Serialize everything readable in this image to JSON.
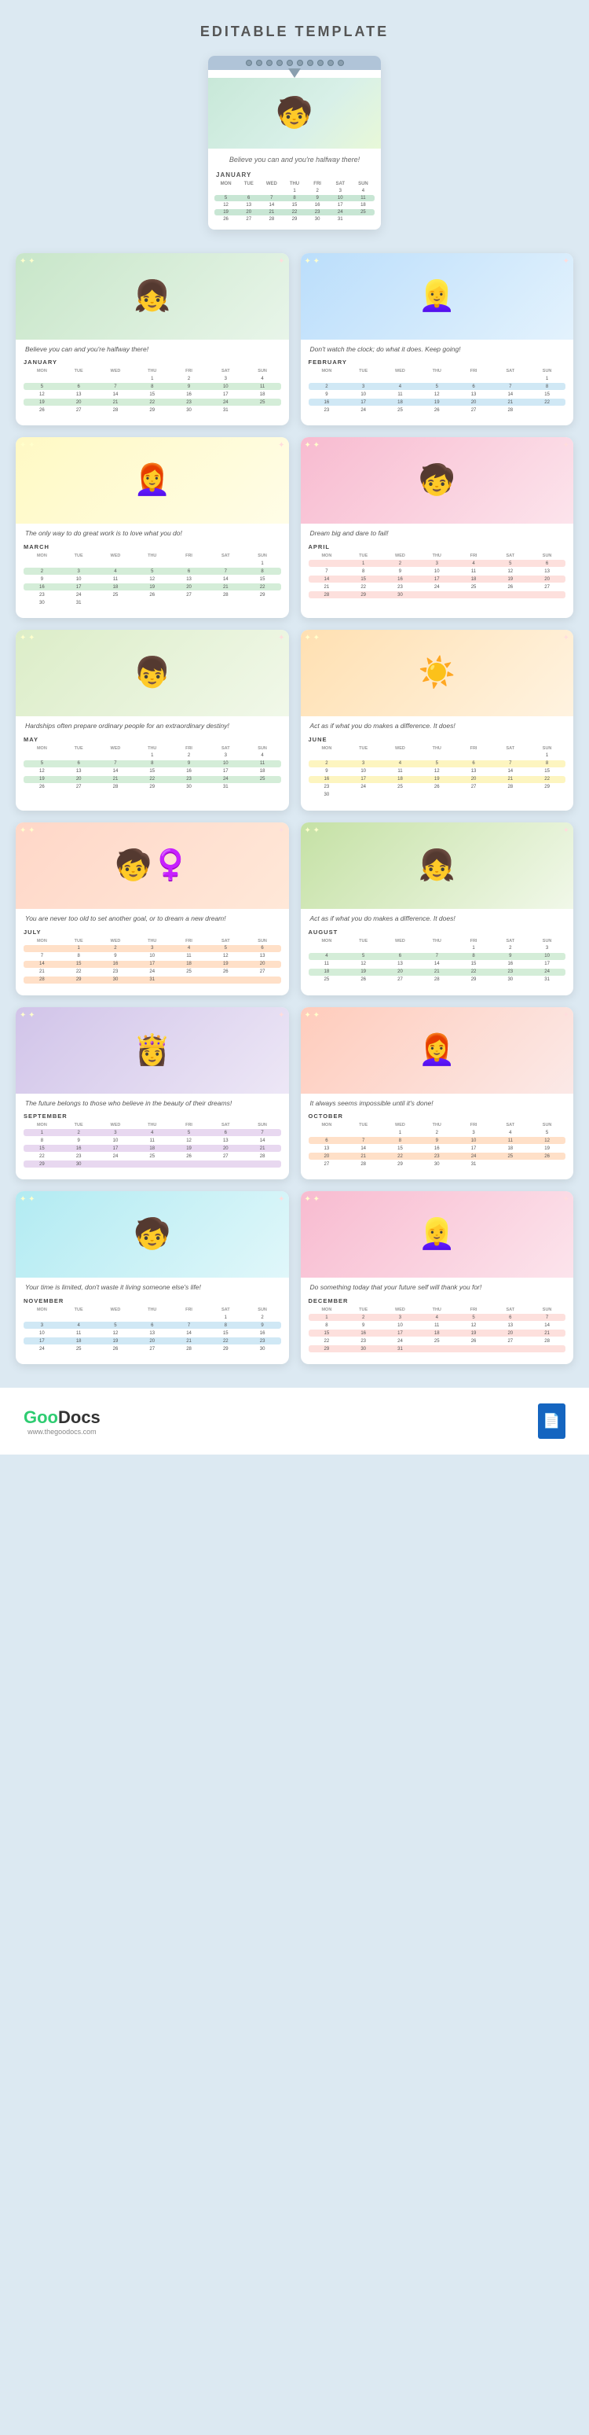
{
  "page": {
    "title": "EDITABLE TEMPLATE",
    "background_color": "#dce9f2"
  },
  "hero": {
    "quote": "Believe you can and you're halfway there!",
    "month": "JANUARY",
    "spiral_count": 12
  },
  "months": [
    {
      "id": "january",
      "label": "JANUARY",
      "quote": "Believe you can and you're halfway there!",
      "emoji": "👧",
      "illus_class": "illus-jan",
      "rows": [
        [
          "",
          "",
          "",
          "1",
          "2",
          "3",
          "4"
        ],
        [
          "5",
          "6",
          "7",
          "8",
          "9",
          "10",
          "11"
        ],
        [
          "12",
          "13",
          "14",
          "15",
          "16",
          "17",
          "18"
        ],
        [
          "19",
          "20",
          "21",
          "22",
          "23",
          "24",
          "25"
        ],
        [
          "26",
          "27",
          "28",
          "29",
          "30",
          "31",
          ""
        ]
      ],
      "row_classes": [
        "",
        "hl-green",
        "",
        "hl-green",
        ""
      ]
    },
    {
      "id": "february",
      "label": "FEBRUARY",
      "quote": "Don't watch the clock; do what it does. Keep going!",
      "emoji": "👱‍♀️",
      "illus_class": "illus-feb",
      "rows": [
        [
          "",
          "",
          "",
          "",
          "",
          "",
          "1"
        ],
        [
          "2",
          "3",
          "4",
          "5",
          "6",
          "7",
          "8"
        ],
        [
          "9",
          "10",
          "11",
          "12",
          "13",
          "14",
          "15"
        ],
        [
          "16",
          "17",
          "18",
          "19",
          "20",
          "21",
          "22"
        ],
        [
          "23",
          "24",
          "25",
          "26",
          "27",
          "28",
          ""
        ]
      ],
      "row_classes": [
        "",
        "hl-blue",
        "",
        "hl-blue",
        ""
      ]
    },
    {
      "id": "march",
      "label": "MARCH",
      "quote": "The only way to do great work is to love what you do!",
      "emoji": "👩‍🦰",
      "illus_class": "illus-mar",
      "rows": [
        [
          "",
          "",
          "",
          "",
          "",
          "",
          "1"
        ],
        [
          "2",
          "3",
          "4",
          "5",
          "6",
          "7",
          "8"
        ],
        [
          "9",
          "10",
          "11",
          "12",
          "13",
          "14",
          "15"
        ],
        [
          "16",
          "17",
          "18",
          "19",
          "20",
          "21",
          "22"
        ],
        [
          "23",
          "24",
          "25",
          "26",
          "27",
          "28",
          "29"
        ],
        [
          "30",
          "31",
          "",
          "",
          "",
          "",
          ""
        ]
      ],
      "row_classes": [
        "",
        "hl-green",
        "",
        "hl-green",
        "",
        ""
      ]
    },
    {
      "id": "april",
      "label": "APRIL",
      "quote": "Dream big and dare to fail!",
      "emoji": "🧒",
      "illus_class": "illus-apr",
      "rows": [
        [
          "",
          "1",
          "2",
          "3",
          "4",
          "5",
          "6"
        ],
        [
          "7",
          "8",
          "9",
          "10",
          "11",
          "12",
          "13"
        ],
        [
          "14",
          "15",
          "16",
          "17",
          "18",
          "19",
          "20"
        ],
        [
          "21",
          "22",
          "23",
          "24",
          "25",
          "26",
          "27"
        ],
        [
          "28",
          "29",
          "30",
          "",
          "",
          "",
          ""
        ]
      ],
      "row_classes": [
        "hl-pink",
        "",
        "hl-pink",
        "",
        "hl-pink"
      ]
    },
    {
      "id": "may",
      "label": "MAY",
      "quote": "Hardships often prepare ordinary people for an extraordinary destiny!",
      "emoji": "👦",
      "illus_class": "illus-may",
      "rows": [
        [
          "",
          "",
          "",
          "1",
          "2",
          "3",
          "4"
        ],
        [
          "5",
          "6",
          "7",
          "8",
          "9",
          "10",
          "11"
        ],
        [
          "12",
          "13",
          "14",
          "15",
          "16",
          "17",
          "18"
        ],
        [
          "19",
          "20",
          "21",
          "22",
          "23",
          "24",
          "25"
        ],
        [
          "26",
          "27",
          "28",
          "29",
          "30",
          "31",
          ""
        ]
      ],
      "row_classes": [
        "",
        "hl-green",
        "",
        "hl-green",
        ""
      ]
    },
    {
      "id": "june",
      "label": "JUNE",
      "quote": "Act as if what you do makes a difference. It does!",
      "emoji": "☀️",
      "illus_class": "illus-jun",
      "rows": [
        [
          "",
          "",
          "",
          "",
          "",
          "",
          "1"
        ],
        [
          "2",
          "3",
          "4",
          "5",
          "6",
          "7",
          "8"
        ],
        [
          "9",
          "10",
          "11",
          "12",
          "13",
          "14",
          "15"
        ],
        [
          "16",
          "17",
          "18",
          "19",
          "20",
          "21",
          "22"
        ],
        [
          "23",
          "24",
          "25",
          "26",
          "27",
          "28",
          "29"
        ],
        [
          "30",
          "",
          "",
          "",
          "",
          "",
          ""
        ]
      ],
      "row_classes": [
        "",
        "hl-yellow",
        "",
        "hl-yellow",
        "",
        ""
      ]
    },
    {
      "id": "july",
      "label": "JULY",
      "quote": "You are never too old to set another goal, or to dream a new dream!",
      "emoji": "🧒‍♀️",
      "illus_class": "illus-jul",
      "rows": [
        [
          "",
          "1",
          "2",
          "3",
          "4",
          "5",
          "6"
        ],
        [
          "7",
          "8",
          "9",
          "10",
          "11",
          "12",
          "13"
        ],
        [
          "14",
          "15",
          "16",
          "17",
          "18",
          "19",
          "20"
        ],
        [
          "21",
          "22",
          "23",
          "24",
          "25",
          "26",
          "27"
        ],
        [
          "28",
          "29",
          "30",
          "31",
          "",
          "",
          ""
        ]
      ],
      "row_classes": [
        "hl-peach",
        "",
        "hl-peach",
        "",
        "hl-peach"
      ]
    },
    {
      "id": "august",
      "label": "AUGUST",
      "quote": "Act as if what you do makes a difference. It does!",
      "emoji": "👧",
      "illus_class": "illus-aug",
      "rows": [
        [
          "",
          "",
          "",
          "",
          "1",
          "2",
          "3"
        ],
        [
          "4",
          "5",
          "6",
          "7",
          "8",
          "9",
          "10"
        ],
        [
          "11",
          "12",
          "13",
          "14",
          "15",
          "16",
          "17"
        ],
        [
          "18",
          "19",
          "20",
          "21",
          "22",
          "23",
          "24"
        ],
        [
          "25",
          "26",
          "27",
          "28",
          "29",
          "30",
          "31"
        ]
      ],
      "row_classes": [
        "",
        "hl-green",
        "",
        "hl-green",
        ""
      ]
    },
    {
      "id": "september",
      "label": "SEPTEMBER",
      "quote": "The future belongs to those who believe in the beauty of their dreams!",
      "emoji": "👸",
      "illus_class": "illus-sep",
      "rows": [
        [
          "1",
          "2",
          "3",
          "4",
          "5",
          "6",
          "7"
        ],
        [
          "8",
          "9",
          "10",
          "11",
          "12",
          "13",
          "14"
        ],
        [
          "15",
          "16",
          "17",
          "18",
          "19",
          "20",
          "21"
        ],
        [
          "22",
          "23",
          "24",
          "25",
          "26",
          "27",
          "28"
        ],
        [
          "29",
          "30",
          "",
          "",
          "",
          "",
          ""
        ]
      ],
      "row_classes": [
        "hl-purple",
        "",
        "hl-purple",
        "",
        "hl-purple"
      ]
    },
    {
      "id": "october",
      "label": "OCTOBER",
      "quote": "It always seems impossible until it's done!",
      "emoji": "👩‍🦰",
      "illus_class": "illus-oct",
      "rows": [
        [
          "",
          "",
          "1",
          "2",
          "3",
          "4",
          "5"
        ],
        [
          "6",
          "7",
          "8",
          "9",
          "10",
          "11",
          "12"
        ],
        [
          "13",
          "14",
          "15",
          "16",
          "17",
          "18",
          "19"
        ],
        [
          "20",
          "21",
          "22",
          "23",
          "24",
          "25",
          "26"
        ],
        [
          "27",
          "28",
          "29",
          "30",
          "31",
          "",
          ""
        ]
      ],
      "row_classes": [
        "",
        "hl-peach",
        "",
        "hl-peach",
        ""
      ]
    },
    {
      "id": "november",
      "label": "NOVEMBER",
      "quote": "Your time is limited, don't waste it living someone else's life!",
      "emoji": "🧒",
      "illus_class": "illus-nov",
      "rows": [
        [
          "",
          "",
          "",
          "",
          "",
          "1",
          "2"
        ],
        [
          "3",
          "4",
          "5",
          "6",
          "7",
          "8",
          "9"
        ],
        [
          "10",
          "11",
          "12",
          "13",
          "14",
          "15",
          "16"
        ],
        [
          "17",
          "18",
          "19",
          "20",
          "21",
          "22",
          "23"
        ],
        [
          "24",
          "25",
          "26",
          "27",
          "28",
          "29",
          "30"
        ]
      ],
      "row_classes": [
        "",
        "hl-blue",
        "",
        "hl-blue",
        ""
      ]
    },
    {
      "id": "december",
      "label": "DECEMBER",
      "quote": "Do something today that your future self will thank you for!",
      "emoji": "👱‍♀️",
      "illus_class": "illus-dec",
      "rows": [
        [
          "1",
          "2",
          "3",
          "4",
          "5",
          "6",
          "7"
        ],
        [
          "8",
          "9",
          "10",
          "11",
          "12",
          "13",
          "14"
        ],
        [
          "15",
          "16",
          "17",
          "18",
          "19",
          "20",
          "21"
        ],
        [
          "22",
          "23",
          "24",
          "25",
          "26",
          "27",
          "28"
        ],
        [
          "29",
          "30",
          "31",
          "",
          "",
          "",
          ""
        ]
      ],
      "row_classes": [
        "hl-pink",
        "",
        "hl-pink",
        "",
        "hl-pink"
      ]
    }
  ],
  "days_header": [
    "MON",
    "TUE",
    "WED",
    "THU",
    "FRI",
    "SAT",
    "SUN"
  ],
  "footer": {
    "logo_green": "Goo",
    "logo_dark": "Docs",
    "url": "www.thegoodocs.com",
    "icon": "📄"
  }
}
